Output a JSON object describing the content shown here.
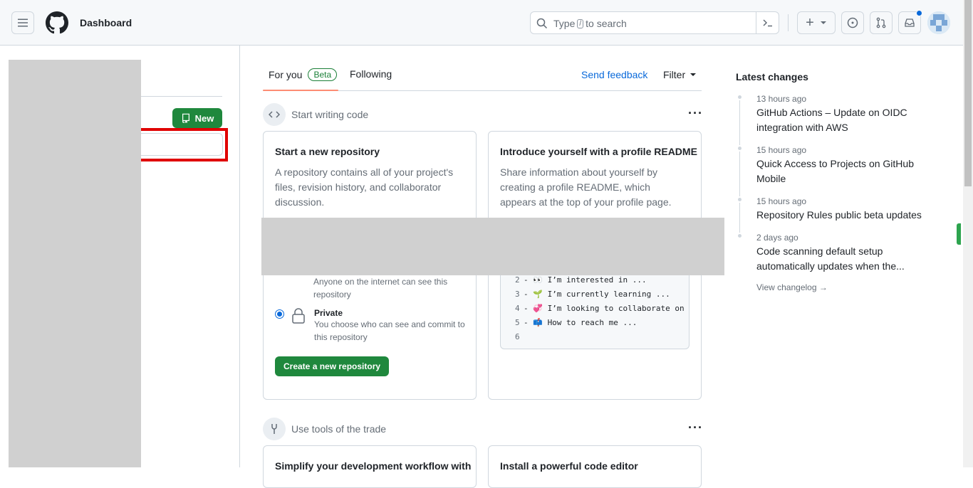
{
  "header": {
    "title": "Dashboard",
    "search_placeholder_pre": "Type",
    "search_key": "/",
    "search_placeholder_post": "to search",
    "create_plus": "+",
    "icons": [
      "menu-icon",
      "github-logo-icon",
      "search-icon",
      "command-palette-icon",
      "plus-icon",
      "issues-icon",
      "pull-requests-icon",
      "inbox-icon",
      "avatar"
    ]
  },
  "left": {
    "new_label": "New"
  },
  "feed": {
    "tabs": [
      {
        "label": "For you",
        "badge": "Beta"
      },
      {
        "label": "Following"
      }
    ],
    "send_feedback": "Send feedback",
    "filter": "Filter",
    "section1": "Start writing code",
    "section2": "Use tools of the trade",
    "card1": {
      "title": "Start a new repository",
      "desc": "A repository contains all of your project's files, revision history, and collaborator discussion.",
      "public_desc": "Anyone on the internet can see this repository",
      "private_title": "Private",
      "private_desc": "You choose who can see and commit to this repository",
      "create_button": "Create a new repository"
    },
    "card2": {
      "title": "Introduce yourself with a profile README",
      "desc": "Share information about yourself by creating a profile README, which appears at the top of your profile page.",
      "code_lines": [
        {
          "n": "2",
          "text": "- 👀 I’m interested in ..."
        },
        {
          "n": "3",
          "text": "- 🌱 I’m currently learning ..."
        },
        {
          "n": "4",
          "text": "- 💞️ I’m looking to collaborate on"
        },
        {
          "n": "5",
          "text": "- 📫 How to reach me ..."
        },
        {
          "n": "6",
          "text": ""
        }
      ]
    },
    "card3": {
      "title": "Simplify your development workflow with"
    },
    "card4": {
      "title": "Install a powerful code editor"
    }
  },
  "changes": {
    "title": "Latest changes",
    "items": [
      {
        "time": "13 hours ago",
        "title": "GitHub Actions – Update on OIDC integration with AWS"
      },
      {
        "time": "15 hours ago",
        "title": "Quick Access to Projects on GitHub Mobile"
      },
      {
        "time": "15 hours ago",
        "title": "Repository Rules public beta updates"
      },
      {
        "time": "2 days ago",
        "title": "Code scanning default setup automatically updates when the..."
      }
    ],
    "view_changelog": "View changelog →"
  },
  "colors": {
    "accent_green": "#1f883d",
    "link_blue": "#0969da",
    "highlight_red": "#e00000",
    "tab_underline": "#fd8c73"
  }
}
